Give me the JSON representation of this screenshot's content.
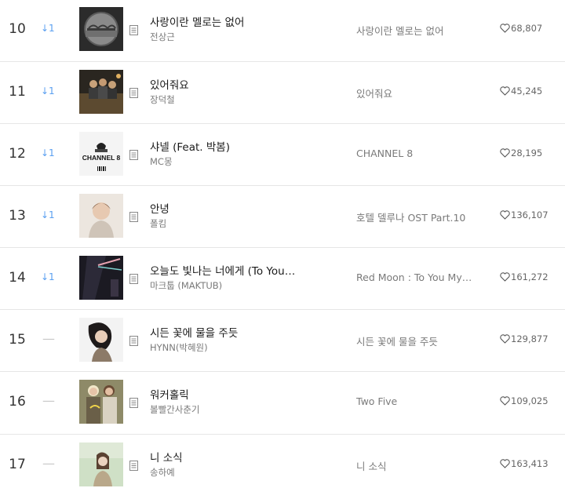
{
  "rows": [
    {
      "rank": "10",
      "change": "↓1",
      "title": "사랑이란 멜로는 없어",
      "artist": "전상근",
      "album": "사랑이란 멜로는 없어",
      "likes": "68,807"
    },
    {
      "rank": "11",
      "change": "↓1",
      "title": "있어줘요",
      "artist": "장덕철",
      "album": "있어줘요",
      "likes": "45,245"
    },
    {
      "rank": "12",
      "change": "↓1",
      "title": "샤넬 (Feat. 박봄)",
      "artist": "MC몽",
      "album": "CHANNEL 8",
      "likes": "28,195",
      "cover_text": "CHANNEL 8"
    },
    {
      "rank": "13",
      "change": "↓1",
      "title": "안녕",
      "artist": "폴킴",
      "album": "호텔 델루나 OST Part.10",
      "likes": "136,107"
    },
    {
      "rank": "14",
      "change": "↓1",
      "title": "오늘도 빛나는 너에게 (To You…",
      "artist": "마크툽 (MAKTUB)",
      "album": "Red Moon : To You My…",
      "likes": "161,272"
    },
    {
      "rank": "15",
      "change": "—",
      "title": "시든 꽃에 물을 주듯",
      "artist": "HYNN(박혜원)",
      "album": "시든 꽃에 물을 주듯",
      "likes": "129,877"
    },
    {
      "rank": "16",
      "change": "—",
      "title": "워커홀릭",
      "artist": "볼빨간사춘기",
      "album": "Two Five",
      "likes": "109,025"
    },
    {
      "rank": "17",
      "change": "—",
      "title": "니 소식",
      "artist": "송하예",
      "album": "니 소식",
      "likes": "163,413"
    }
  ],
  "icons": {
    "detail": "document-icon",
    "like": "heart-icon"
  },
  "colors": {
    "rank_down": "#5a9ff0",
    "rank_same": "#c8c8c8"
  }
}
